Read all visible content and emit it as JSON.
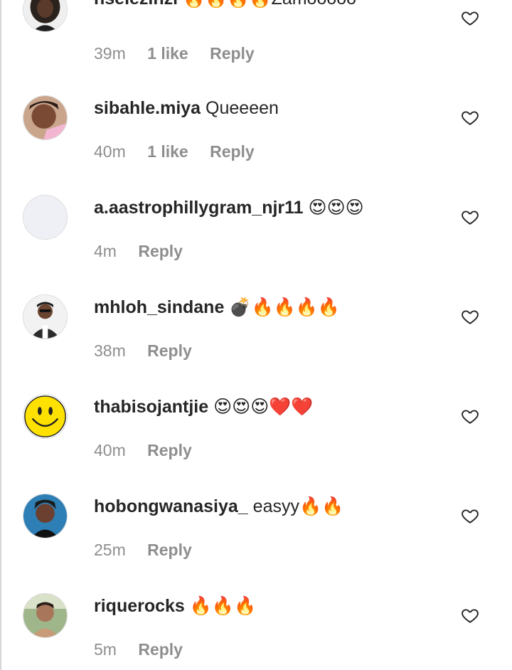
{
  "comments": [
    {
      "username": "nselezinzi",
      "text": "🔥🔥🔥🔥Zamooooo",
      "time": "39m",
      "likes": "1 like",
      "reply": "Reply",
      "avatar_style": "dark"
    },
    {
      "username": "sibahle.miya",
      "text": "Queeeen",
      "time": "40m",
      "likes": "1 like",
      "reply": "Reply",
      "avatar_style": "selfie"
    },
    {
      "username": "a.aastrophillygram_njr11",
      "text": "😍😍😍",
      "time": "4m",
      "likes": "",
      "reply": "Reply",
      "avatar_style": "blank"
    },
    {
      "username": "mhloh_sindane",
      "text": "💣🔥🔥🔥🔥",
      "time": "38m",
      "likes": "",
      "reply": "Reply",
      "avatar_style": "portrait"
    },
    {
      "username": "thabisojantjie",
      "text": "😍😍😍❤️❤️",
      "time": "40m",
      "likes": "",
      "reply": "Reply",
      "avatar_style": "smiley"
    },
    {
      "username": "hobongwanasiya_",
      "text": "easyy🔥🔥",
      "time": "25m",
      "likes": "",
      "reply": "Reply",
      "avatar_style": "blue"
    },
    {
      "username": "riquerocks",
      "text": "🔥🔥🔥",
      "time": "5m",
      "likes": "",
      "reply": "Reply",
      "avatar_style": "outdoor"
    }
  ],
  "icons": {
    "like": "heart-outline-icon"
  },
  "colors": {
    "username": "#262626",
    "meta": "#8e8e8e",
    "background": "#ffffff"
  }
}
